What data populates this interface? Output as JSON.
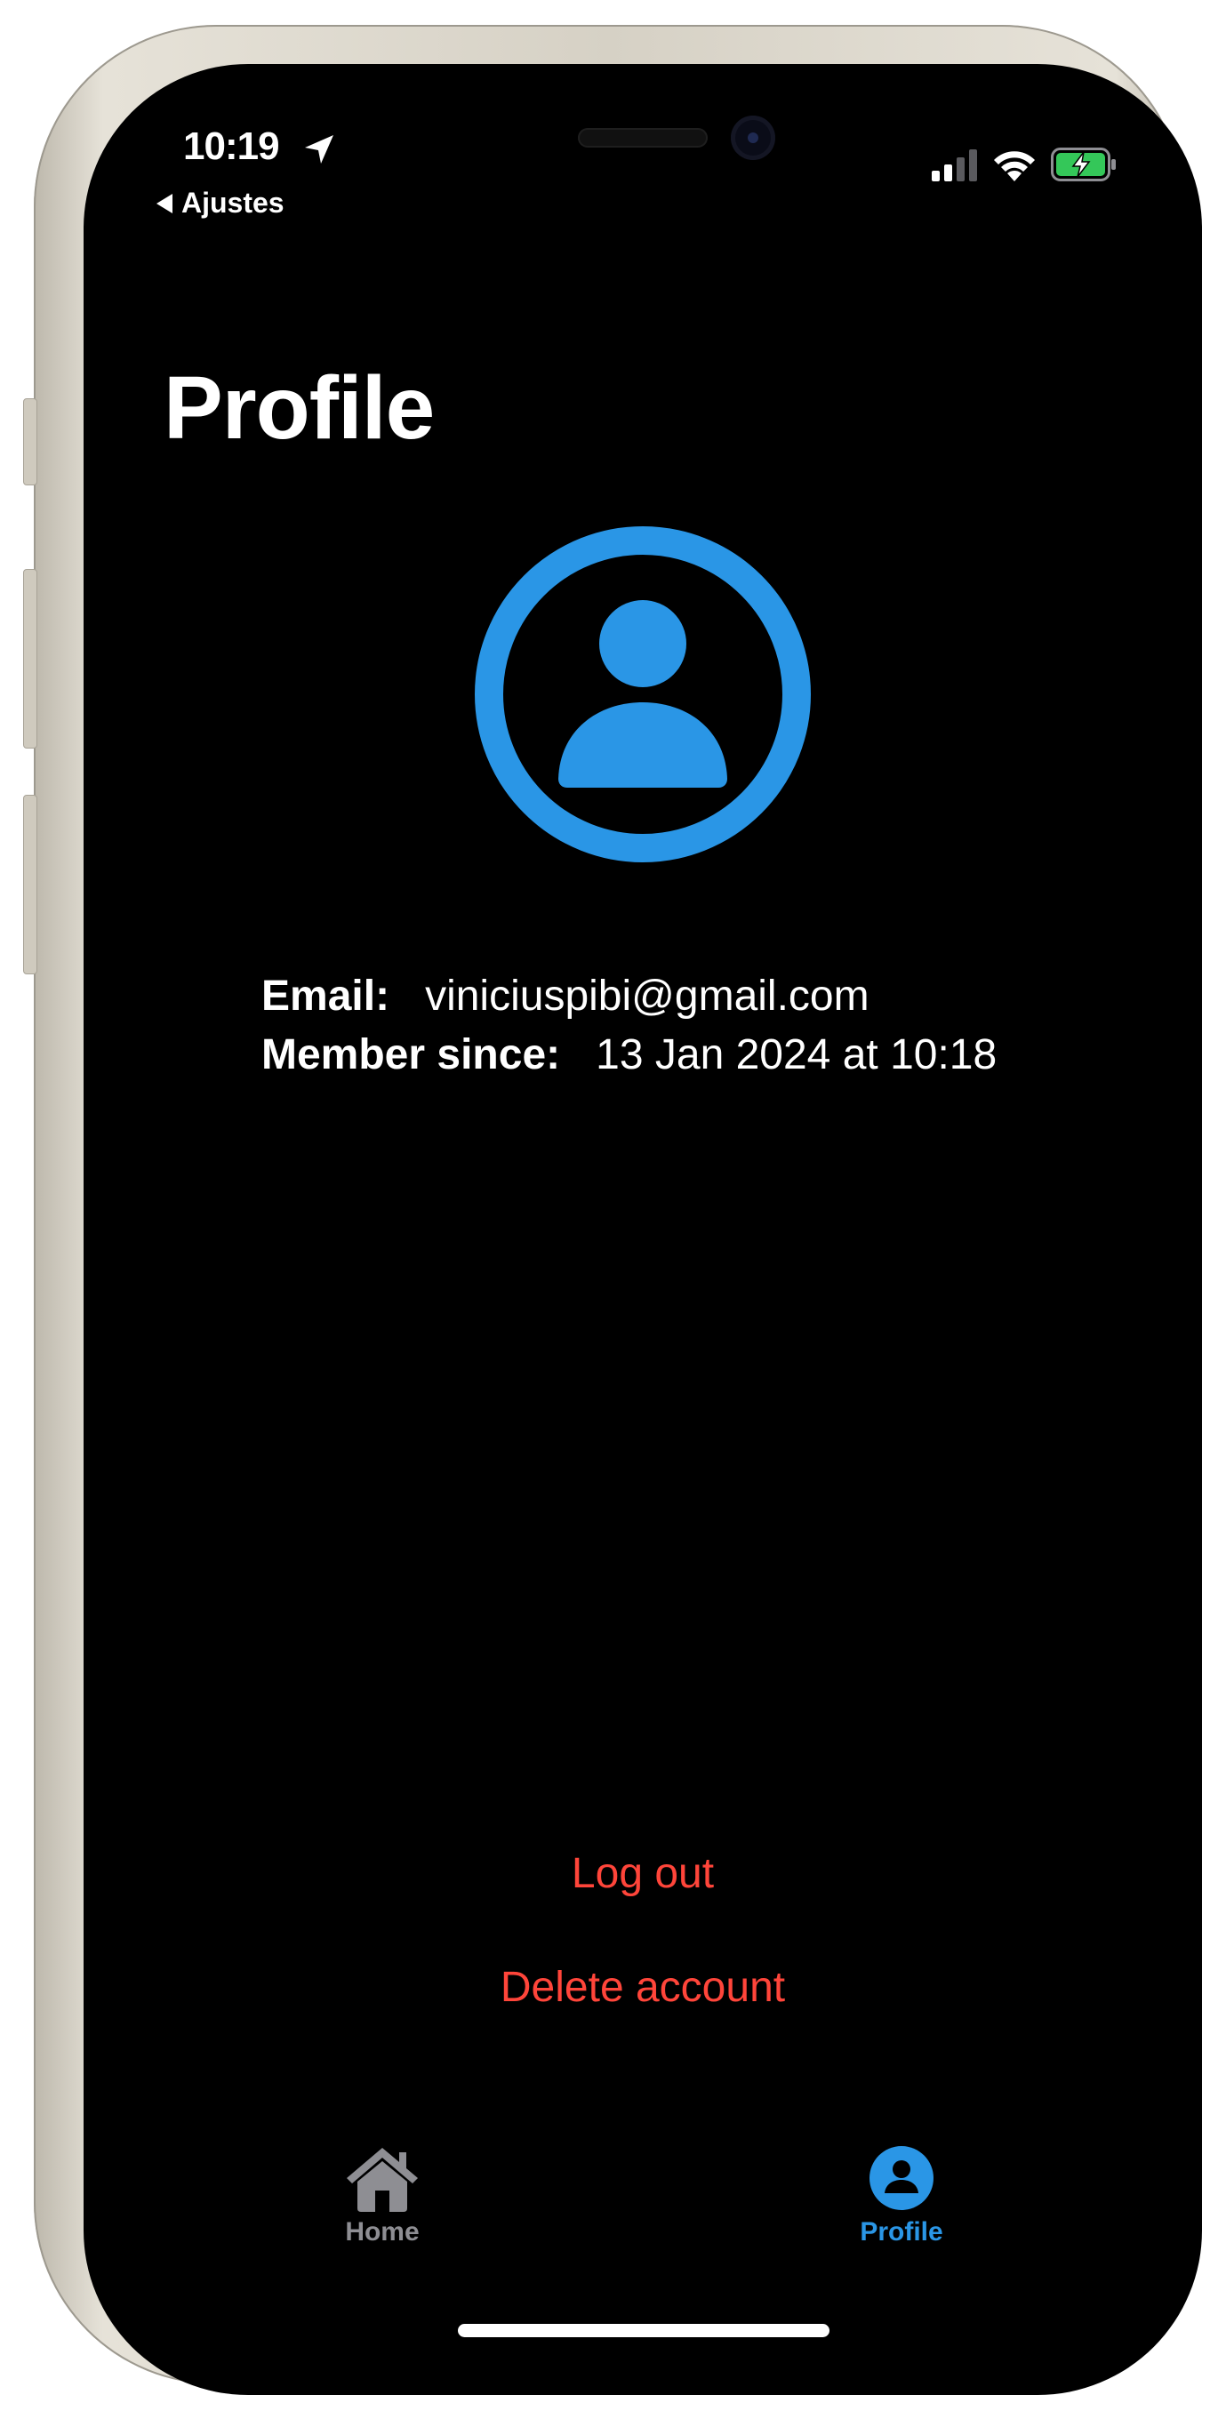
{
  "status_bar": {
    "time": "10:19",
    "back_label": "Ajustes",
    "location_icon": "location-arrow-icon",
    "signal_icon": "cellular-signal-icon",
    "wifi_icon": "wifi-icon",
    "battery_icon": "battery-charging-icon"
  },
  "page": {
    "title": "Profile",
    "avatar_icon": "person-circle-icon",
    "accent_color": "#2a96e6"
  },
  "profile_info": {
    "email_label": "Email:",
    "email_value": "viniciuspibi@gmail.com",
    "member_label": "Member since:",
    "member_value": "13 Jan 2024 at 10:18"
  },
  "actions": {
    "logout_label": "Log out",
    "delete_label": "Delete account",
    "destructive_color": "#ff453a"
  },
  "tab_bar": {
    "tabs": [
      {
        "label": "Home",
        "icon": "house-icon",
        "selected": false,
        "color": "#8e8e93"
      },
      {
        "label": "Profile",
        "icon": "person-circle-icon",
        "selected": true,
        "color": "#2a96e6"
      }
    ]
  }
}
